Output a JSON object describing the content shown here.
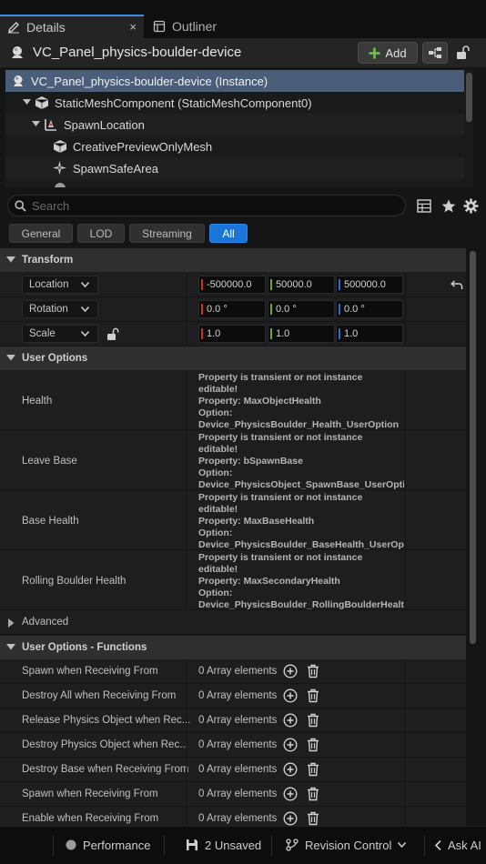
{
  "tabs": [
    {
      "label": "Details",
      "icon": "pencil-icon"
    },
    {
      "label": "Outliner",
      "icon": "outliner-icon"
    }
  ],
  "tab_close": "×",
  "header": {
    "title": "VC_Panel_physics-boulder-device",
    "add_label": "Add"
  },
  "tree": [
    {
      "label": "VC_Panel_physics-boulder-device (Instance)",
      "icon": "actor-icon",
      "selected": true
    },
    {
      "label": "StaticMeshComponent (StaticMeshComponent0)",
      "icon": "static-mesh-icon"
    },
    {
      "label": "SpawnLocation",
      "icon": "spawn-location-icon"
    },
    {
      "label": "CreativePreviewOnlyMesh",
      "icon": "static-mesh-icon"
    },
    {
      "label": "SpawnSafeArea",
      "icon": "safe-area-icon"
    }
  ],
  "search": {
    "placeholder": "Search"
  },
  "filters": [
    "General",
    "LOD",
    "Streaming",
    "All"
  ],
  "active_filter": "All",
  "transform": {
    "header": "Transform",
    "location": {
      "label": "Location",
      "x": "-500000.0",
      "y": "50000.0",
      "z": "500000.0"
    },
    "rotation": {
      "label": "Rotation",
      "x": "0.0 °",
      "y": "0.0 °",
      "z": "0.0 °"
    },
    "scale": {
      "label": "Scale",
      "x": "1.0",
      "y": "1.0",
      "z": "1.0"
    }
  },
  "user_options": {
    "header": "User Options",
    "rows": [
      {
        "name": "Health",
        "l1": "Property is transient or not instance",
        "l2": "editable!",
        "l3": "Property: MaxObjectHealth",
        "l4": "Option:",
        "l5": "Device_PhysicsBoulder_Health_UserOption"
      },
      {
        "name": "Leave Base",
        "l1": "Property is transient or not instance",
        "l2": "editable!",
        "l3": "Property: bSpawnBase",
        "l4": "Option:",
        "l5": "Device_PhysicsObject_SpawnBase_UserOpti"
      },
      {
        "name": "Base Health",
        "l1": "Property is transient or not instance",
        "l2": "editable!",
        "l3": "Property: MaxBaseHealth",
        "l4": "Option:",
        "l5": "Device_PhysicsBoulder_BaseHealth_UserOpt"
      },
      {
        "name": "Rolling Boulder Health",
        "l1": "Property is transient or not instance",
        "l2": "editable!",
        "l3": "Property: MaxSecondaryHealth",
        "l4": "Option:",
        "l5": "Device_PhysicsBoulder_RollingBoulderHealth"
      }
    ]
  },
  "advanced": {
    "header": "Advanced"
  },
  "functions": {
    "header": "User Options - Functions",
    "rows": [
      {
        "name": "Spawn when Receiving From",
        "value": "0 Array elements"
      },
      {
        "name": "Destroy All when Receiving From",
        "value": "0 Array elements"
      },
      {
        "name": "Release Physics Object when Rec...",
        "value": "0 Array elements"
      },
      {
        "name": "Destroy Physics Object when Rec...",
        "value": "0 Array elements"
      },
      {
        "name": "Destroy Base when Receiving From",
        "value": "0 Array elements"
      },
      {
        "name": "Spawn when Receiving From",
        "value": "0 Array elements"
      },
      {
        "name": "Enable when Receiving From",
        "value": "0 Array elements"
      }
    ]
  },
  "statusbar": {
    "performance": "Performance",
    "unsaved": "2 Unsaved",
    "revision": "Revision Control",
    "ask_ai": "Ask AI"
  },
  "colors": {
    "accent": "#1a75d8",
    "selection": "#4a5e7a",
    "axis_x": "#c8322c",
    "axis_y": "#6aa830",
    "axis_z": "#2c6ad0",
    "add_icon": "#6cc04a"
  }
}
